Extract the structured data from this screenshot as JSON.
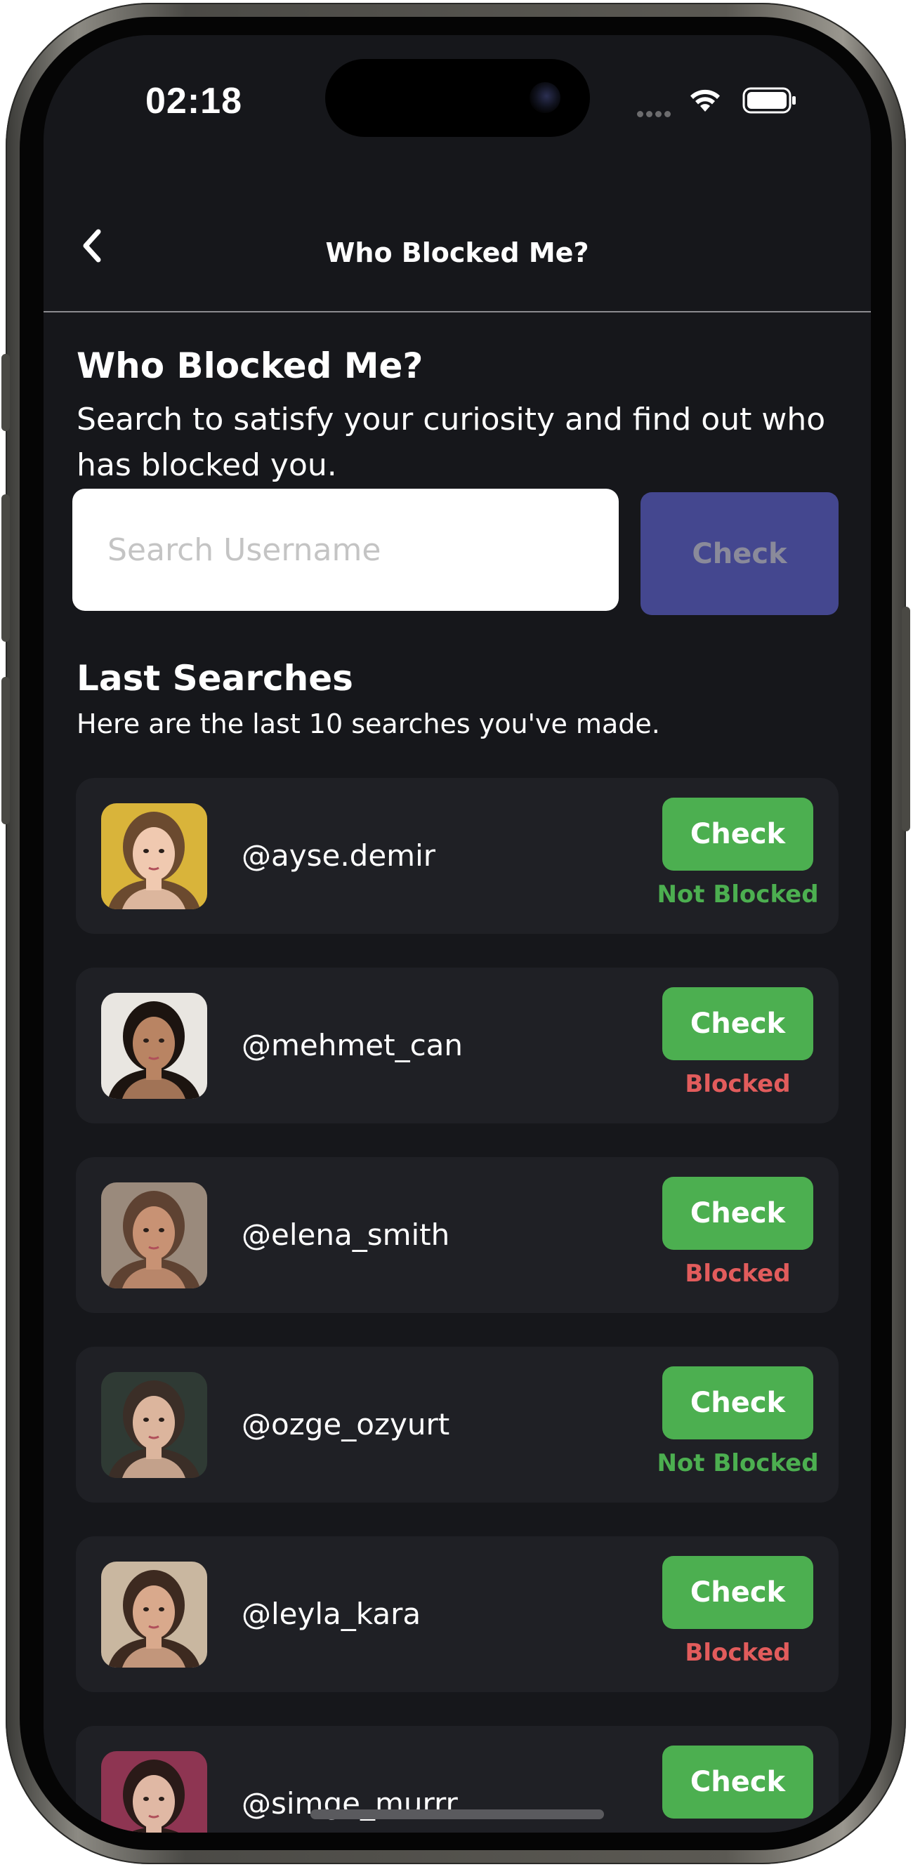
{
  "status_bar": {
    "time": "02:18",
    "signal_icon": "signal-dots-icon",
    "wifi_icon": "wifi-icon",
    "battery_icon": "battery-icon"
  },
  "nav": {
    "back_icon": "chevron-left-icon",
    "title": "Who Blocked Me?"
  },
  "intro": {
    "heading": "Who Blocked Me?",
    "subheading": "Search to satisfy your curiosity and find out who has blocked you."
  },
  "search": {
    "value": "",
    "placeholder": "Search Username",
    "button_label": "Check"
  },
  "last_searches": {
    "title": "Last Searches",
    "subtitle": "Here are the last 10 searches you've made.",
    "items": [
      {
        "username": "@ayse.demir",
        "button_label": "Check",
        "status": "Not Blocked",
        "status_color": "#4caf50",
        "avatar_bg": "#d9b43a",
        "hair": "#6b4a2f",
        "skin": "#f0c9b0"
      },
      {
        "username": "@mehmet_can",
        "button_label": "Check",
        "status": "Blocked",
        "status_color": "#e25c5c",
        "avatar_bg": "#e9e6e1",
        "hair": "#1c1410",
        "skin": "#b98463"
      },
      {
        "username": "@elena_smith",
        "button_label": "Check",
        "status": "Blocked",
        "status_color": "#e25c5c",
        "avatar_bg": "#9a8a7c",
        "hair": "#5e4232",
        "skin": "#c89274"
      },
      {
        "username": "@ozge_ozyurt",
        "button_label": "Check",
        "status": "Not Blocked",
        "status_color": "#4caf50",
        "avatar_bg": "#2f3a34",
        "hair": "#3b2e27",
        "skin": "#dcb59d"
      },
      {
        "username": "@leyla_kara",
        "button_label": "Check",
        "status": "Blocked",
        "status_color": "#e25c5c",
        "avatar_bg": "#c9b7a0",
        "hair": "#3d2a20",
        "skin": "#d9a98c"
      },
      {
        "username": "@simge_murrr",
        "button_label": "Check",
        "status": "",
        "status_color": "#4caf50",
        "avatar_bg": "#8e3552",
        "hair": "#2a1a18",
        "skin": "#e0b8a4"
      }
    ]
  },
  "colors": {
    "background": "#16171b",
    "card": "#1f2025",
    "accent_green": "#4caf50",
    "blocked_red": "#e25c5c",
    "disabled_button": "#44478f"
  }
}
